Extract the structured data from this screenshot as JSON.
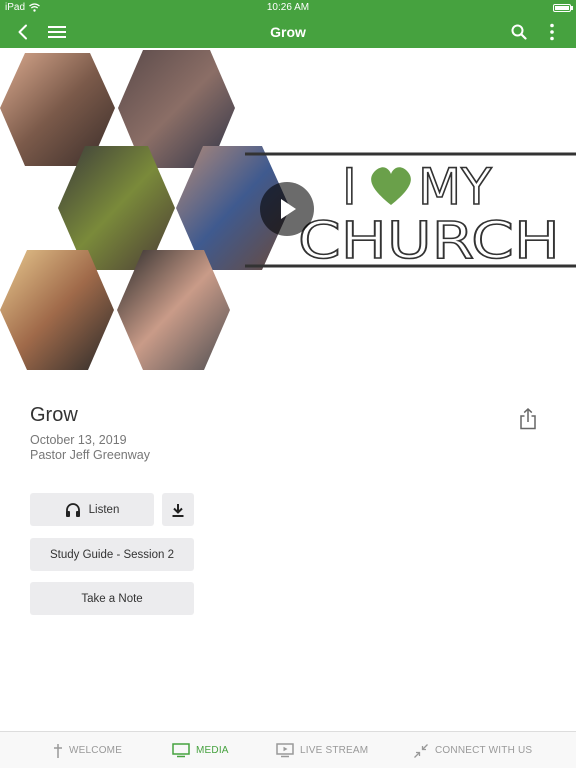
{
  "status_bar": {
    "carrier": "iPad",
    "time": "10:26 AM"
  },
  "nav": {
    "title": "Grow"
  },
  "hero": {
    "banner_line1_prefix": "I",
    "banner_line1_suffix": "MY",
    "banner_line2": "CHURCH",
    "heart_color": "#6aa04a"
  },
  "sermon": {
    "title": "Grow",
    "date": "October 13, 2019",
    "speaker": "Pastor Jeff Greenway"
  },
  "actions": {
    "listen_label": "Listen",
    "study_guide_label": "Study Guide - Session 2",
    "note_label": "Take a Note"
  },
  "tabs": [
    {
      "label": "WELCOME",
      "icon": "cross-icon",
      "active": false
    },
    {
      "label": "MEDIA",
      "icon": "monitor-icon",
      "active": true
    },
    {
      "label": "LIVE STREAM",
      "icon": "play-screen-icon",
      "active": false
    },
    {
      "label": "CONNECT WITH US",
      "icon": "arrows-in-icon",
      "active": false
    }
  ],
  "colors": {
    "brand_green": "#46a23f",
    "button_bg": "#ececee"
  }
}
